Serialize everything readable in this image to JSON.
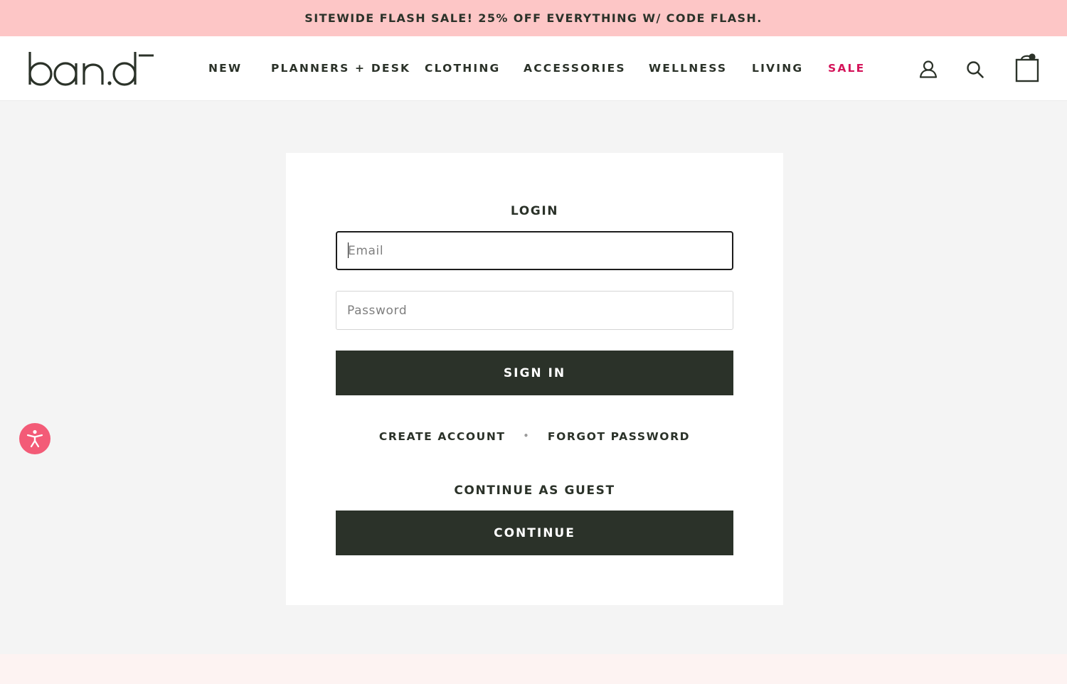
{
  "announcement": {
    "text": "SITEWIDE FLASH SALE! 25% OFF EVERYTHING W/ CODE FLASH."
  },
  "header": {
    "logo_text": "ban.dō",
    "nav": [
      {
        "label": "NEW"
      },
      {
        "label": "PLANNERS + DESK"
      },
      {
        "label": "CLOTHING"
      },
      {
        "label": "ACCESSORIES"
      },
      {
        "label": "WELLNESS"
      },
      {
        "label": "LIVING"
      },
      {
        "label": "SALE"
      }
    ],
    "icons": [
      "account-icon",
      "search-icon",
      "cart-icon"
    ]
  },
  "login": {
    "title": "LOGIN",
    "email_placeholder": "Email",
    "password_placeholder": "Password",
    "sign_in_label": "SIGN IN",
    "create_account_label": "CREATE ACCOUNT",
    "separator": "•",
    "forgot_password_label": "FORGOT PASSWORD",
    "guest_title": "CONTINUE AS GUEST",
    "continue_label": "CONTINUE"
  },
  "accessibility": {
    "icon": "accessibility-icon"
  },
  "colors": {
    "announcement_bg": "#fdc6c6",
    "brand_dark": "#2b3229",
    "sale": "#d4145a",
    "page_bg": "#f4f4f4",
    "accessibility": "#f35b77"
  }
}
